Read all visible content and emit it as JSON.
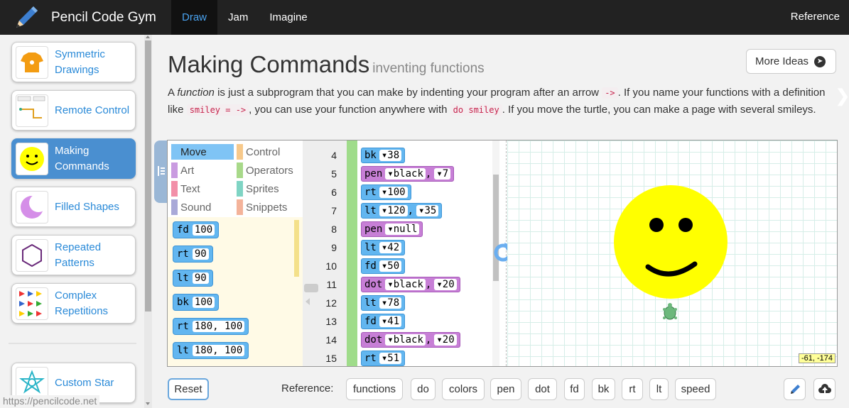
{
  "nav": {
    "brand": "Pencil Code Gym",
    "tabs": [
      "Draw",
      "Jam",
      "Imagine"
    ],
    "active_tab": "Draw",
    "reference": "Reference"
  },
  "sidebar": {
    "items": [
      {
        "label": "Symmetric Drawings",
        "icon": "tshirt-icon"
      },
      {
        "label": "Remote Control",
        "icon": "remote-control-icon"
      },
      {
        "label": "Making Commands",
        "icon": "smiley-icon",
        "active": true
      },
      {
        "label": "Filled Shapes",
        "icon": "moon-icon"
      },
      {
        "label": "Repeated Patterns",
        "icon": "hexagon-icon"
      },
      {
        "label": "Complex Repetitions",
        "icon": "arrows-icon"
      },
      {
        "label": "Custom Star",
        "icon": "star-icon"
      }
    ],
    "status_url": "https://pencilcode.net"
  },
  "header": {
    "title": "Making Commands",
    "subtitle": "inventing functions",
    "more_ideas": "More Ideas"
  },
  "description": {
    "t1": "A ",
    "em": "function",
    "t2": " is just a subprogram that you can make by indenting your program after an arrow ",
    "c1": "->",
    "t3": ". If you name your functions with a definition like ",
    "c2": "smiley = ->",
    "t4": ", you can use your function anywhere with ",
    "c3": "do smiley",
    "t5": ". If you move the turtle, you can make a page with several smileys."
  },
  "palette": {
    "categories": [
      {
        "label": "Move",
        "color": "#7fc4f5",
        "selected": true
      },
      {
        "label": "Control",
        "color": "#f7c98b"
      },
      {
        "label": "Art",
        "color": "#c99be0"
      },
      {
        "label": "Operators",
        "color": "#a8d98a"
      },
      {
        "label": "Text",
        "color": "#f28fa8"
      },
      {
        "label": "Sprites",
        "color": "#7fd4c4"
      },
      {
        "label": "Sound",
        "color": "#a9a9d8"
      },
      {
        "label": "Snippets",
        "color": "#f4b39a"
      }
    ],
    "blocks": [
      {
        "cmd": "fd",
        "args": "100"
      },
      {
        "cmd": "rt",
        "args": "90"
      },
      {
        "cmd": "lt",
        "args": "90"
      },
      {
        "cmd": "bk",
        "args": "100"
      },
      {
        "cmd": "rt",
        "args": "180, 100"
      },
      {
        "cmd": "lt",
        "args": "180, 100"
      }
    ]
  },
  "code": {
    "lines": [
      {
        "n": "4",
        "cmd": "bk",
        "a1": "38",
        "color": "blue"
      },
      {
        "n": "5",
        "cmd": "pen",
        "a1": "black",
        "a2": "7",
        "color": "purple"
      },
      {
        "n": "6",
        "cmd": "rt",
        "a1": "100",
        "color": "blue"
      },
      {
        "n": "7",
        "cmd": "lt",
        "a1": "120",
        "a2": "35",
        "color": "blue"
      },
      {
        "n": "8",
        "cmd": "pen",
        "a1": "null",
        "color": "purple"
      },
      {
        "n": "9",
        "cmd": "lt",
        "a1": "42",
        "color": "blue"
      },
      {
        "n": "10",
        "cmd": "fd",
        "a1": "50",
        "color": "blue"
      },
      {
        "n": "11",
        "cmd": "dot",
        "a1": "black",
        "a2": "20",
        "color": "purple"
      },
      {
        "n": "12",
        "cmd": "lt",
        "a1": "78",
        "color": "blue"
      },
      {
        "n": "13",
        "cmd": "fd",
        "a1": "41",
        "color": "blue"
      },
      {
        "n": "14",
        "cmd": "dot",
        "a1": "black",
        "a2": "20",
        "color": "purple"
      },
      {
        "n": "15",
        "cmd": "rt",
        "a1": "51",
        "color": "blue"
      }
    ]
  },
  "canvas": {
    "coords": "-61, -174"
  },
  "footer": {
    "reset": "Reset",
    "reference_label": "Reference:",
    "refs": [
      "functions",
      "do",
      "colors",
      "pen",
      "dot",
      "fd",
      "bk",
      "rt",
      "lt",
      "speed"
    ]
  }
}
